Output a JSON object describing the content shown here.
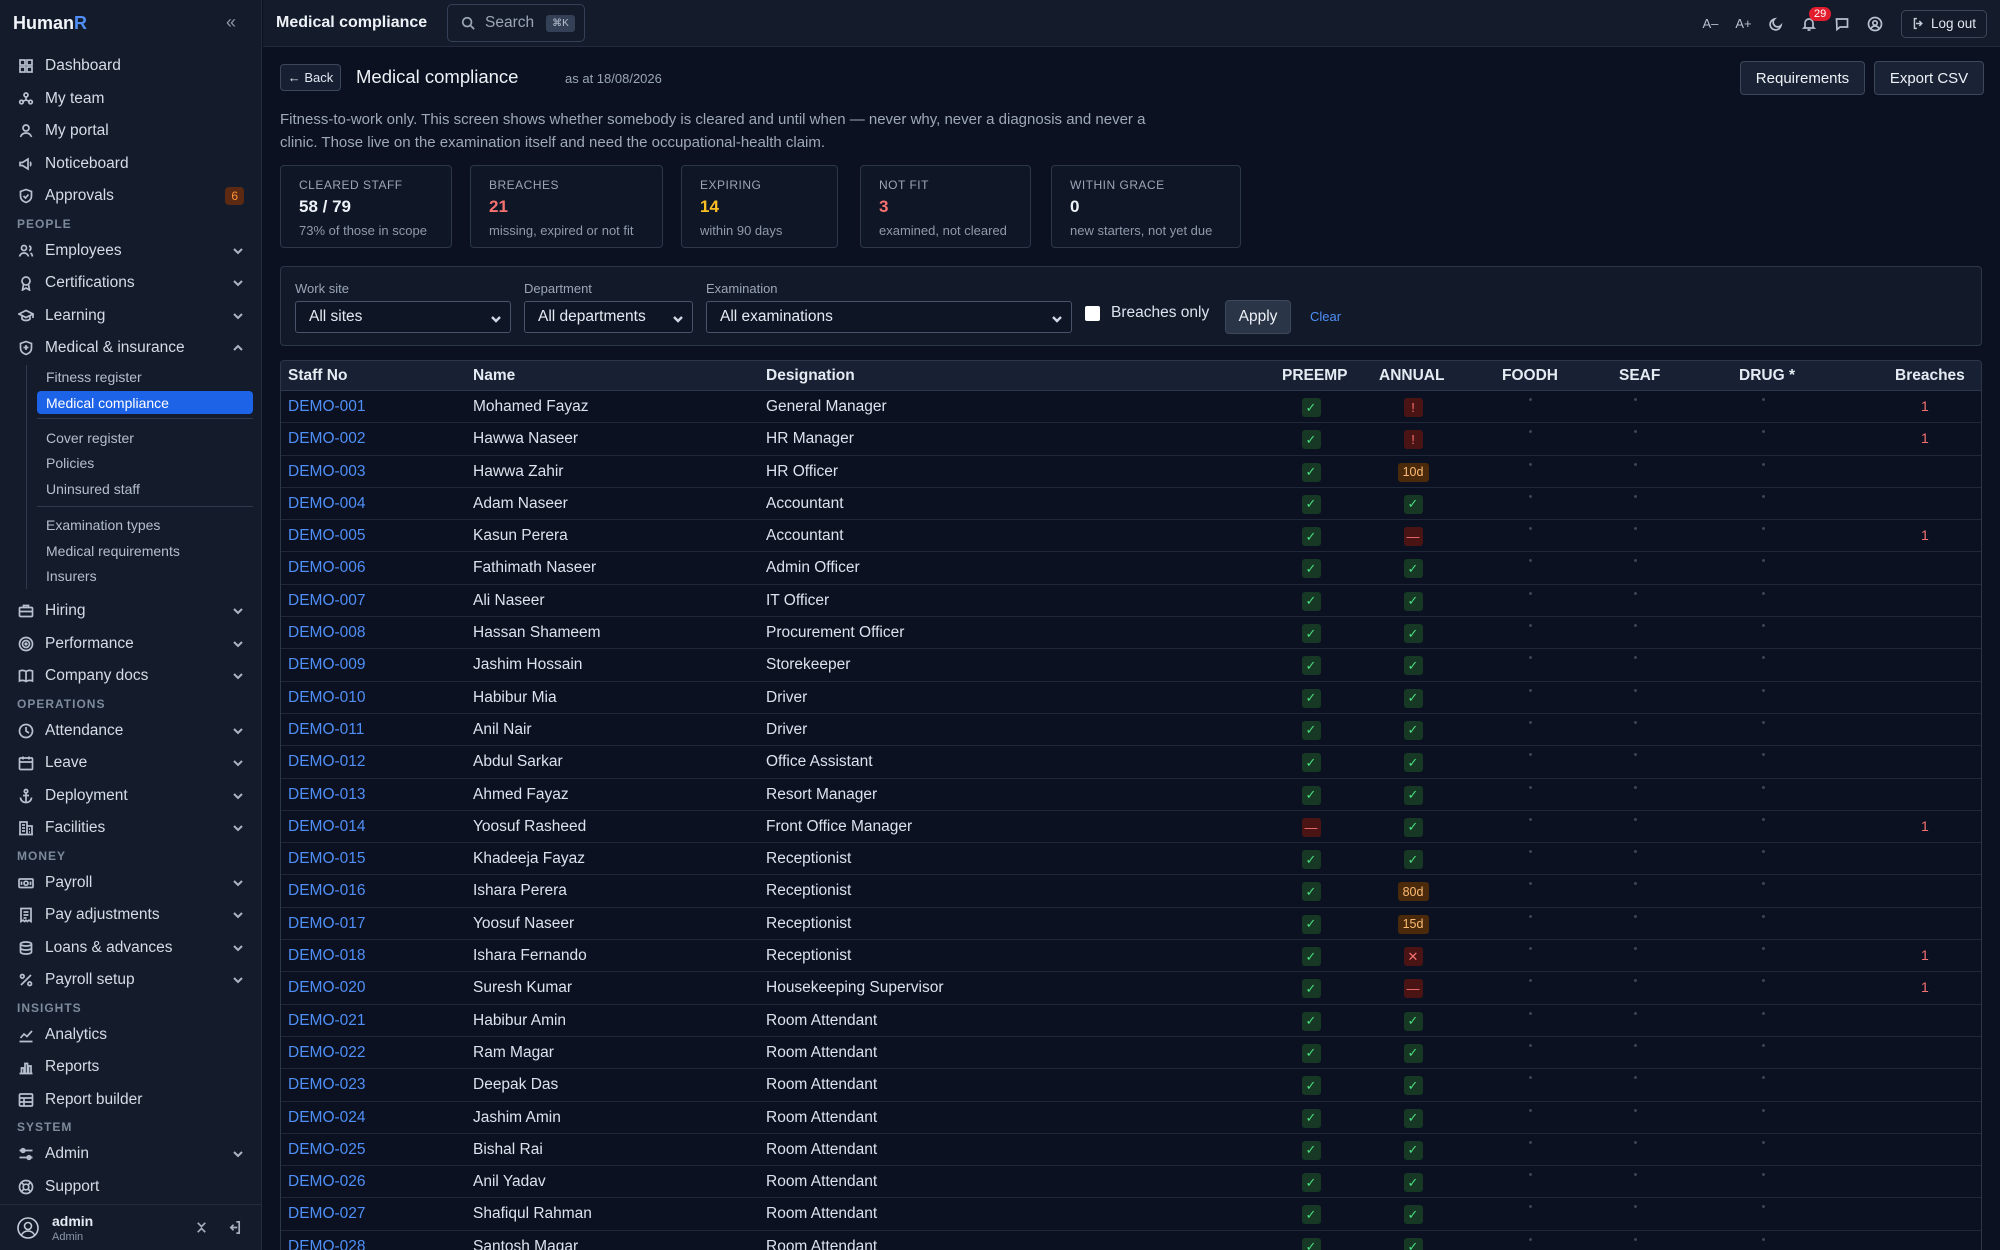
{
  "brand": {
    "name": "Human",
    "accent": "R"
  },
  "sidebar": {
    "items_top": [
      {
        "label": "Dashboard",
        "icon": "grid-icon"
      },
      {
        "label": "My team",
        "icon": "team-icon"
      },
      {
        "label": "My portal",
        "icon": "person-icon"
      },
      {
        "label": "Noticeboard",
        "icon": "megaphone-icon"
      },
      {
        "label": "Approvals",
        "icon": "shield-check-icon",
        "badge": "6"
      }
    ],
    "section_people": "PEOPLE",
    "people": [
      {
        "label": "Employees",
        "icon": "users-icon"
      },
      {
        "label": "Certifications",
        "icon": "award-icon"
      },
      {
        "label": "Learning",
        "icon": "graduation-cap-icon"
      },
      {
        "label": "Medical & insurance",
        "icon": "shield-icon"
      }
    ],
    "medical_sub": [
      "Fitness register",
      "Medical compliance"
    ],
    "medical_sub2": [
      "Cover register",
      "Policies",
      "Uninsured staff"
    ],
    "medical_sub3": [
      "Examination types",
      "Medical requirements",
      "Insurers"
    ],
    "people2": [
      {
        "label": "Hiring",
        "icon": "briefcase-icon"
      },
      {
        "label": "Performance",
        "icon": "target-icon"
      },
      {
        "label": "Company docs",
        "icon": "book-icon"
      }
    ],
    "section_operations": "OPERATIONS",
    "operations": [
      {
        "label": "Attendance",
        "icon": "clock-icon"
      },
      {
        "label": "Leave",
        "icon": "calendar-icon"
      },
      {
        "label": "Deployment",
        "icon": "anchor-icon"
      },
      {
        "label": "Facilities",
        "icon": "building-icon"
      }
    ],
    "section_money": "MONEY",
    "money": [
      {
        "label": "Payroll",
        "icon": "banknote-icon"
      },
      {
        "label": "Pay adjustments",
        "icon": "receipt-icon"
      },
      {
        "label": "Loans & advances",
        "icon": "coins-icon"
      },
      {
        "label": "Payroll setup",
        "icon": "percent-icon"
      }
    ],
    "section_insights": "INSIGHTS",
    "insights": [
      {
        "label": "Analytics",
        "icon": "trend-icon"
      },
      {
        "label": "Reports",
        "icon": "bar-chart-icon"
      },
      {
        "label": "Report builder",
        "icon": "table-icon"
      }
    ],
    "section_system": "SYSTEM",
    "system": [
      {
        "label": "Admin",
        "icon": "sliders-icon"
      },
      {
        "label": "Support",
        "icon": "lifebuoy-icon"
      }
    ],
    "user": {
      "name": "admin",
      "role": "Admin"
    }
  },
  "topbar": {
    "title": "Medical compliance",
    "search_label": "Search",
    "search_kbd": "⌘K",
    "font_dec": "A–",
    "font_inc": "A+",
    "notifications": "29",
    "logout": "Log out"
  },
  "page": {
    "back": "← Back",
    "title": "Medical compliance",
    "as_at": "as at 18/08/2026",
    "btn_requirements": "Requirements",
    "btn_export": "Export CSV",
    "description": "Fitness-to-work only. This screen shows whether somebody is cleared and until when — never why, never a diagnosis and never a clinic. Those live on the examination itself and need the occupational-health claim."
  },
  "stats": [
    {
      "label": "CLEARED STAFF",
      "value": "58 / 79",
      "sub": "73% of those in scope",
      "color": "#eef2f7"
    },
    {
      "label": "BREACHES",
      "value": "21",
      "sub": "missing, expired or not fit",
      "color": "#f87171"
    },
    {
      "label": "EXPIRING",
      "value": "14",
      "sub": "within 90 days",
      "color": "#fbbf24"
    },
    {
      "label": "NOT FIT",
      "value": "3",
      "sub": "examined, not cleared",
      "color": "#f87171"
    },
    {
      "label": "WITHIN GRACE",
      "value": "0",
      "sub": "new starters, not yet due",
      "color": "#eef2f7"
    }
  ],
  "filters": {
    "work_site_label": "Work site",
    "work_site_value": "All sites",
    "department_label": "Department",
    "department_value": "All departments",
    "examination_label": "Examination",
    "examination_value": "All examinations",
    "breaches_only": "Breaches only",
    "apply": "Apply",
    "clear": "Clear"
  },
  "table": {
    "headers": [
      "Staff No",
      "Name",
      "Designation",
      "PREEMP",
      "ANNUAL",
      "FOODH",
      "SEAF",
      "DRUG *",
      "Breaches"
    ],
    "rows": [
      {
        "staff": "DEMO-001",
        "name": "Mohamed Fayaz",
        "designation": "General Manager",
        "preemp": "ok",
        "annual": "!",
        "breaches": "1"
      },
      {
        "staff": "DEMO-002",
        "name": "Hawwa Naseer",
        "designation": "HR Manager",
        "preemp": "ok",
        "annual": "!",
        "breaches": "1"
      },
      {
        "staff": "DEMO-003",
        "name": "Hawwa Zahir",
        "designation": "HR Officer",
        "preemp": "ok",
        "annual": "10d",
        "breaches": ""
      },
      {
        "staff": "DEMO-004",
        "name": "Adam Naseer",
        "designation": "Accountant",
        "preemp": "ok",
        "annual": "ok",
        "breaches": ""
      },
      {
        "staff": "DEMO-005",
        "name": "Kasun Perera",
        "designation": "Accountant",
        "preemp": "ok",
        "annual": "—",
        "breaches": "1"
      },
      {
        "staff": "DEMO-006",
        "name": "Fathimath Naseer",
        "designation": "Admin Officer",
        "preemp": "ok",
        "annual": "ok",
        "breaches": ""
      },
      {
        "staff": "DEMO-007",
        "name": "Ali Naseer",
        "designation": "IT Officer",
        "preemp": "ok",
        "annual": "ok",
        "breaches": ""
      },
      {
        "staff": "DEMO-008",
        "name": "Hassan Shameem",
        "designation": "Procurement Officer",
        "preemp": "ok",
        "annual": "ok",
        "breaches": ""
      },
      {
        "staff": "DEMO-009",
        "name": "Jashim Hossain",
        "designation": "Storekeeper",
        "preemp": "ok",
        "annual": "ok",
        "breaches": ""
      },
      {
        "staff": "DEMO-010",
        "name": "Habibur Mia",
        "designation": "Driver",
        "preemp": "ok",
        "annual": "ok",
        "breaches": ""
      },
      {
        "staff": "DEMO-011",
        "name": "Anil Nair",
        "designation": "Driver",
        "preemp": "ok",
        "annual": "ok",
        "breaches": ""
      },
      {
        "staff": "DEMO-012",
        "name": "Abdul Sarkar",
        "designation": "Office Assistant",
        "preemp": "ok",
        "annual": "ok",
        "breaches": ""
      },
      {
        "staff": "DEMO-013",
        "name": "Ahmed Fayaz",
        "designation": "Resort Manager",
        "preemp": "ok",
        "annual": "ok",
        "breaches": ""
      },
      {
        "staff": "DEMO-014",
        "name": "Yoosuf Rasheed",
        "designation": "Front Office Manager",
        "preemp": "—",
        "annual": "ok",
        "breaches": "1"
      },
      {
        "staff": "DEMO-015",
        "name": "Khadeeja Fayaz",
        "designation": "Receptionist",
        "preemp": "ok",
        "annual": "ok",
        "breaches": ""
      },
      {
        "staff": "DEMO-016",
        "name": "Ishara Perera",
        "designation": "Receptionist",
        "preemp": "ok",
        "annual": "80d",
        "breaches": ""
      },
      {
        "staff": "DEMO-017",
        "name": "Yoosuf Naseer",
        "designation": "Receptionist",
        "preemp": "ok",
        "annual": "15d",
        "breaches": ""
      },
      {
        "staff": "DEMO-018",
        "name": "Ishara Fernando",
        "designation": "Receptionist",
        "preemp": "ok",
        "annual": "✕",
        "breaches": "1"
      },
      {
        "staff": "DEMO-020",
        "name": "Suresh Kumar",
        "designation": "Housekeeping Supervisor",
        "preemp": "ok",
        "annual": "—",
        "breaches": "1"
      },
      {
        "staff": "DEMO-021",
        "name": "Habibur Amin",
        "designation": "Room Attendant",
        "preemp": "ok",
        "annual": "ok",
        "breaches": ""
      },
      {
        "staff": "DEMO-022",
        "name": "Ram Magar",
        "designation": "Room Attendant",
        "preemp": "ok",
        "annual": "ok",
        "breaches": ""
      },
      {
        "staff": "DEMO-023",
        "name": "Deepak Das",
        "designation": "Room Attendant",
        "preemp": "ok",
        "annual": "ok",
        "breaches": ""
      },
      {
        "staff": "DEMO-024",
        "name": "Jashim Amin",
        "designation": "Room Attendant",
        "preemp": "ok",
        "annual": "ok",
        "breaches": ""
      },
      {
        "staff": "DEMO-025",
        "name": "Bishal Rai",
        "designation": "Room Attendant",
        "preemp": "ok",
        "annual": "ok",
        "breaches": ""
      },
      {
        "staff": "DEMO-026",
        "name": "Anil Yadav",
        "designation": "Room Attendant",
        "preemp": "ok",
        "annual": "ok",
        "breaches": ""
      },
      {
        "staff": "DEMO-027",
        "name": "Shafiqul Rahman",
        "designation": "Room Attendant",
        "preemp": "ok",
        "annual": "ok",
        "breaches": ""
      },
      {
        "staff": "DEMO-028",
        "name": "Santosh Magar",
        "designation": "Room Attendant",
        "preemp": "ok",
        "annual": "ok",
        "breaches": ""
      }
    ]
  }
}
